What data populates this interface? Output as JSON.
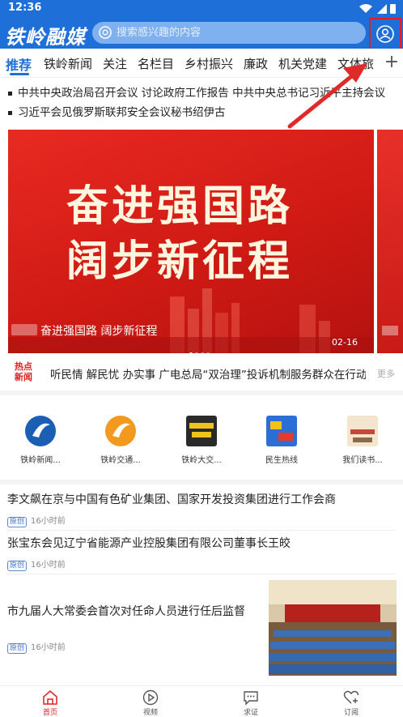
{
  "status_bar": {
    "time": "12:36"
  },
  "header": {
    "logo": "铁岭融媒",
    "search_placeholder": "搜索感兴趣的内容",
    "brand_color": "#1f6fd8"
  },
  "channels": {
    "tabs": [
      {
        "label": "推荐",
        "active": true
      },
      {
        "label": "铁岭新闻"
      },
      {
        "label": "关注"
      },
      {
        "label": "名栏目"
      },
      {
        "label": "乡村振兴"
      },
      {
        "label": "廉政"
      },
      {
        "label": "机关党建"
      },
      {
        "label": "文体旅"
      }
    ],
    "add_label": "+"
  },
  "headlines": [
    "中共中央政治局召开会议 讨论政府工作报告 中共中央总书记习近平主持会议",
    "习近平会见俄罗斯联邦安全会议秘书绍伊古"
  ],
  "banner": {
    "line1": "奋进强国路",
    "line2": "阔步新征程",
    "caption": "奋进强国路 阔步新征程",
    "date": "02-16",
    "slides_total": 4,
    "slide_active": 1
  },
  "hot_news": {
    "badge_line1": "热点",
    "badge_line2": "新闻",
    "text": "听民情 解民忧 办实事 广电总局“双治理”投诉机制服务群众在行动",
    "more": "更多"
  },
  "services": [
    {
      "label": "铁岭新闻...",
      "icon": "tieling-news-logo"
    },
    {
      "label": "铁岭交通...",
      "icon": "tieling-traffic-logo"
    },
    {
      "label": "铁岭大交...",
      "icon": "tieling-big-traffic-logo"
    },
    {
      "label": "民生热线",
      "icon": "hotline-logo"
    },
    {
      "label": "我们读书...",
      "icon": "reading-logo"
    }
  ],
  "news": [
    {
      "title": "李文飙在京与中国有色矿业集团、国家开发投资集团进行工作会商",
      "tag": "原创",
      "time": "16小时前"
    },
    {
      "title": "张宝东会见辽宁省能源产业控股集团有限公司董事长王皎",
      "tag": "原创",
      "time": "16小时前"
    },
    {
      "title": "市九届人大常委会首次对任命人员进行任后监督",
      "tag": "原创",
      "time": "16小时前",
      "has_image": true
    }
  ],
  "bottom_nav": [
    {
      "label": "首页",
      "icon": "home-icon",
      "active": true
    },
    {
      "label": "视频",
      "icon": "play-icon"
    },
    {
      "label": "求证",
      "icon": "chat-icon"
    },
    {
      "label": "订阅",
      "icon": "heart-plus-icon"
    }
  ]
}
